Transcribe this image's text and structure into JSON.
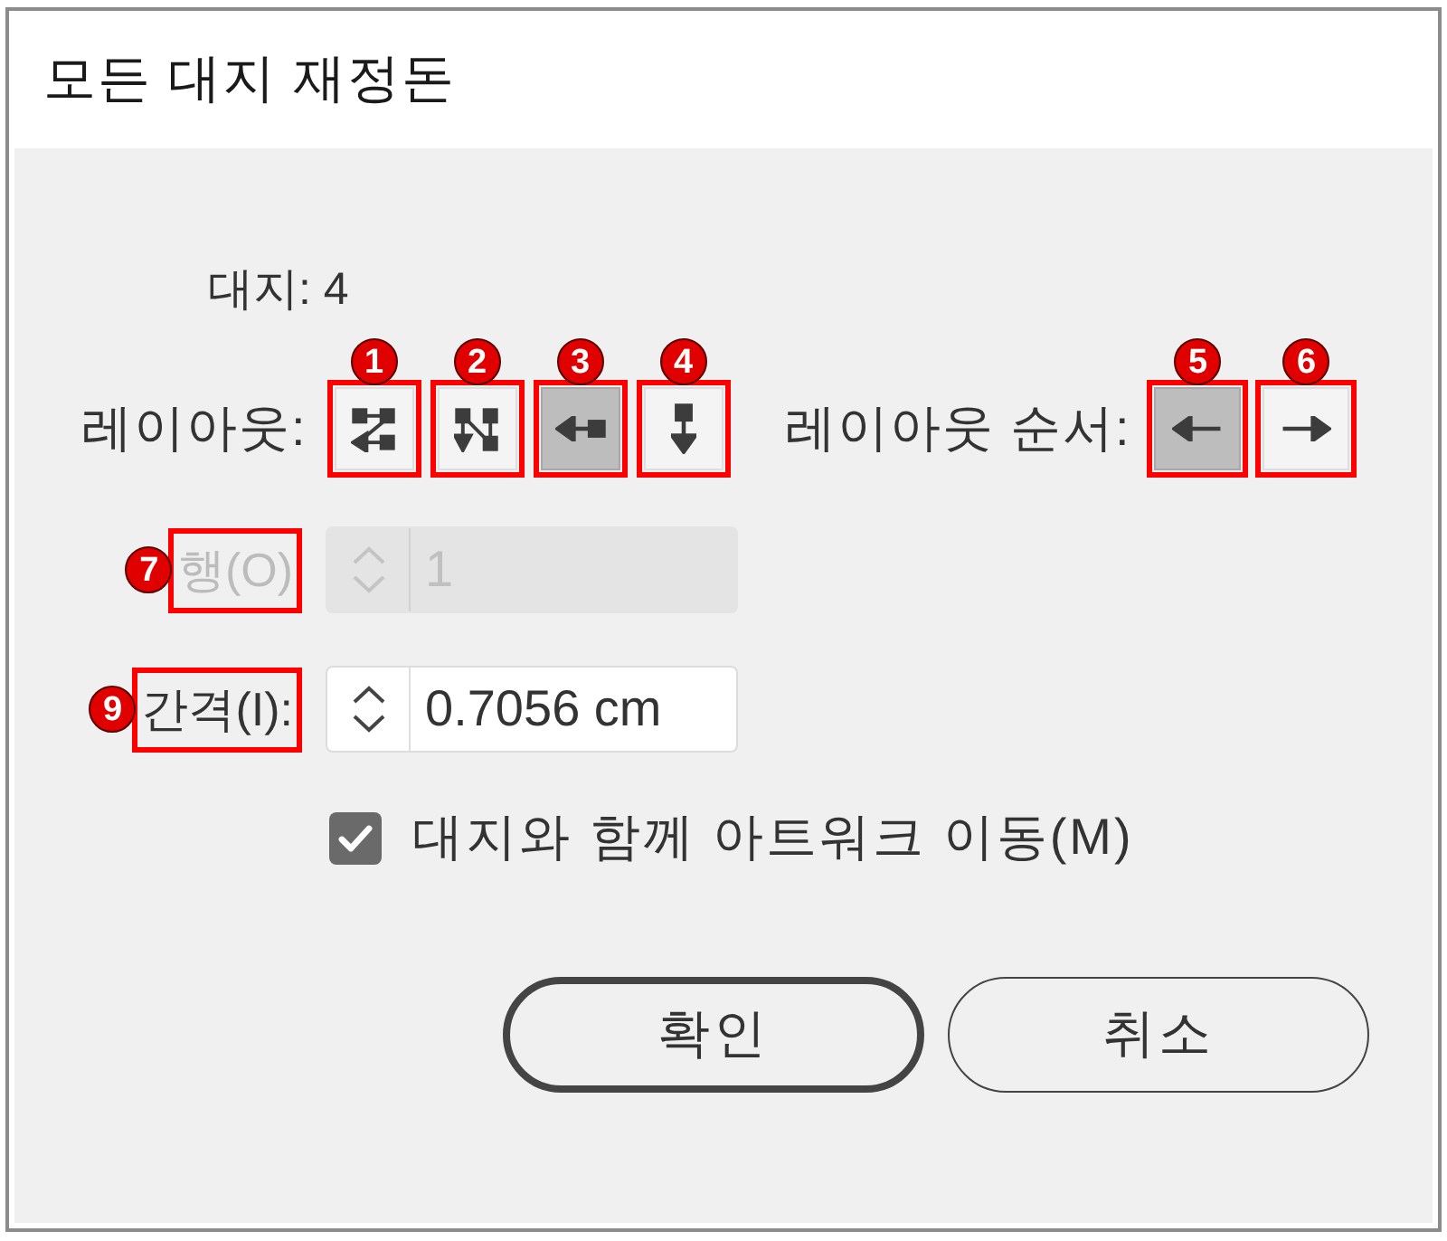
{
  "window": {
    "title": "모든 대지 재정돈"
  },
  "artboards": {
    "text": "대지: 4"
  },
  "layout": {
    "label": "레이아웃:",
    "options": [
      {
        "kind": "gridrow",
        "badge": "1",
        "selected": false
      },
      {
        "kind": "gridcolumn",
        "badge": "2",
        "selected": false
      },
      {
        "kind": "row",
        "badge": "3",
        "selected": true
      },
      {
        "kind": "column",
        "badge": "4",
        "selected": false
      }
    ]
  },
  "layout_order": {
    "label": "레이아웃 순서:",
    "options": [
      {
        "kind": "left",
        "badge": "5",
        "selected": true
      },
      {
        "kind": "right",
        "badge": "6",
        "selected": false
      }
    ]
  },
  "fields": [
    {
      "label": "행(O)",
      "value": "1",
      "disabled": true,
      "badge": "7"
    },
    {
      "label": "간격(I):",
      "value": "0.7056 cm",
      "disabled": false,
      "badge": "9"
    }
  ],
  "move_artwork": {
    "label": "대지와 함께 아트워크 이동(M)",
    "checked": true
  },
  "buttons": [
    {
      "label": "확인",
      "default": true
    },
    {
      "label": "취소",
      "default": false
    }
  ]
}
